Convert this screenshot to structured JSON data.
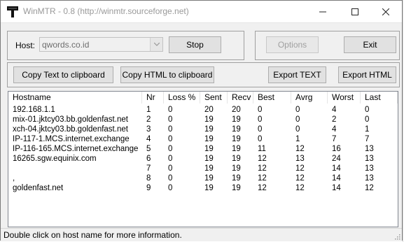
{
  "window": {
    "title": "WinMTR - 0.8 (http://winmtr.sourceforge.net)",
    "icon": "winmtr-app-icon",
    "controls": [
      "minimize-icon",
      "maximize-icon",
      "close-icon"
    ]
  },
  "host": {
    "label": "Host:",
    "value": "qwords.co.id"
  },
  "buttons": {
    "stop": "Stop",
    "options": "Options",
    "exit": "Exit",
    "copy_text": "Copy Text to clipboard",
    "copy_html": "Copy HTML to clipboard",
    "export_text": "Export TEXT",
    "export_html": "Export HTML"
  },
  "table": {
    "columns": [
      "Hostname",
      "Nr",
      "Loss %",
      "Sent",
      "Recv",
      "Best",
      "Avrg",
      "Worst",
      "Last"
    ],
    "rows": [
      [
        "192.168.1.1",
        "1",
        "0",
        "20",
        "20",
        "0",
        "0",
        "4",
        "0"
      ],
      [
        "mix-01.jktcy03.bb.goldenfast.net",
        "2",
        "0",
        "19",
        "19",
        "0",
        "0",
        "2",
        "0"
      ],
      [
        "xch-04.jktcy03.bb.goldenfast.net",
        "3",
        "0",
        "19",
        "19",
        "0",
        "0",
        "4",
        "1"
      ],
      [
        "IP-117-1.MCS.internet.exchange",
        "4",
        "0",
        "19",
        "19",
        "0",
        "1",
        "7",
        "7"
      ],
      [
        "IP-116-165.MCS.internet.exchange",
        "5",
        "0",
        "19",
        "19",
        "11",
        "12",
        "16",
        "13"
      ],
      [
        "16265.sgw.equinix.com",
        "6",
        "0",
        "19",
        "19",
        "12",
        "13",
        "24",
        "13"
      ],
      [
        "",
        "7",
        "0",
        "19",
        "19",
        "12",
        "12",
        "14",
        "13"
      ],
      [
        ",",
        "8",
        "0",
        "19",
        "19",
        "12",
        "12",
        "14",
        "13"
      ],
      [
        "goldenfast.net",
        "9",
        "0",
        "19",
        "19",
        "12",
        "12",
        "14",
        "12"
      ]
    ]
  },
  "status": {
    "text": "Double click on host name for more information."
  }
}
